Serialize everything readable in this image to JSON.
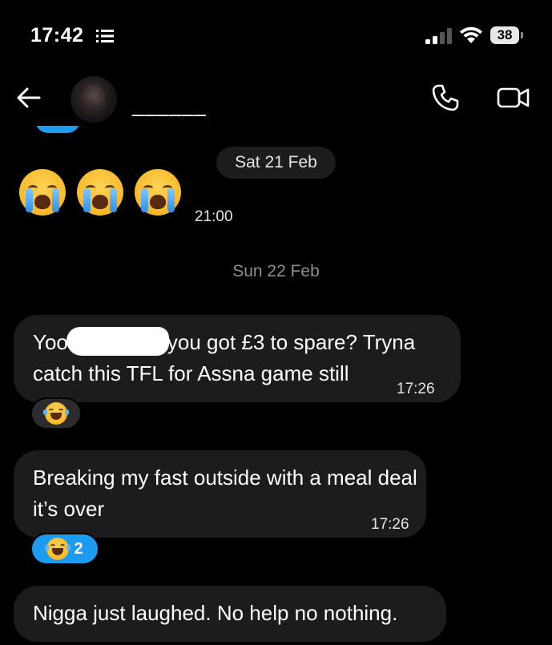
{
  "status_bar": {
    "time": "17:42",
    "battery": "38"
  },
  "header": {
    "contact_name": "______"
  },
  "dates": {
    "first": "Sat 21 Feb",
    "second": "Sun 22 Feb"
  },
  "messages": [
    {
      "type": "emoji",
      "content": "😭😭😭",
      "time": "21:00"
    },
    {
      "type": "text",
      "text_before_redaction": "Yoo",
      "text_after_redaction": "you got £3 to spare? Tryna catch this TFL for Assna game still",
      "time": "17:26",
      "reaction": {
        "emoji": "😂"
      }
    },
    {
      "type": "text",
      "text": "Breaking my fast outside with a meal deal it’s over",
      "time": "17:26",
      "reaction": {
        "emoji": "😂",
        "count": "2"
      }
    },
    {
      "type": "text",
      "text": "Nigga just laughed. No help no nothing."
    }
  ],
  "icons": {
    "back": "back-arrow-icon",
    "phone": "phone-icon",
    "video": "video-camera-icon",
    "signal": "cellular-signal-icon",
    "wifi": "wifi-icon",
    "battery": "battery-icon",
    "focus": "list-icon"
  },
  "colors": {
    "background": "#000000",
    "bubble": "#1c1c1e",
    "accent": "#1d9bf0"
  }
}
